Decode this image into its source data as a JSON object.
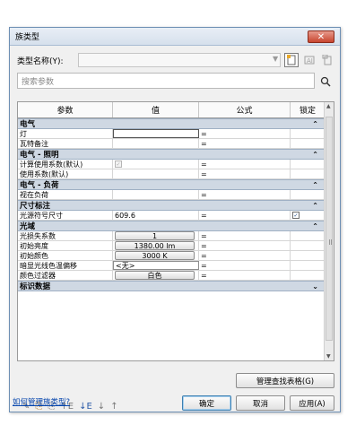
{
  "window": {
    "title": "族类型",
    "close": "✕"
  },
  "type_name": {
    "label": "类型名称(Y):",
    "value": ""
  },
  "search": {
    "placeholder": "搜索参数"
  },
  "grid": {
    "headers": [
      "参数",
      "值",
      "公式",
      "锁定"
    ],
    "groups": [
      {
        "title": "电气",
        "chevron": "⌃",
        "rows": [
          {
            "param": "灯",
            "value": "",
            "formula": "=",
            "kind": "boxed"
          },
          {
            "param": "瓦特备注",
            "value": "",
            "formula": "=",
            "kind": "plain"
          }
        ]
      },
      {
        "title": "电气 - 照明",
        "chevron": "⌃",
        "rows": [
          {
            "param": "计算使用系数(默认)",
            "value": "",
            "formula": "=",
            "kind": "checkbox-disabled"
          },
          {
            "param": "使用系数(默认)",
            "value": "",
            "formula": "=",
            "kind": "plain"
          }
        ]
      },
      {
        "title": "电气 - 负荷",
        "chevron": "⌃",
        "rows": [
          {
            "param": "视在负荷",
            "value": "",
            "formula": "=",
            "kind": "plain"
          }
        ]
      },
      {
        "title": "尺寸标注",
        "chevron": "⌃",
        "rows": [
          {
            "param": "光源符号尺寸",
            "value": "609.6",
            "formula": "=",
            "kind": "plain",
            "locked": true
          }
        ]
      },
      {
        "title": "光域",
        "chevron": "⌃",
        "rows": [
          {
            "param": "光损失系数",
            "value": "1",
            "formula": "=",
            "kind": "button"
          },
          {
            "param": "初始亮度",
            "value": "1380.00 lm",
            "formula": "=",
            "kind": "button"
          },
          {
            "param": "初始颜色",
            "value": "3000 K",
            "formula": "=",
            "kind": "button"
          },
          {
            "param": "暗显光线色温偏移",
            "value": "<无>",
            "formula": "=",
            "kind": "dropdown"
          },
          {
            "param": "颜色过滤器",
            "value": "白色",
            "formula": "=",
            "kind": "button"
          }
        ]
      },
      {
        "title": "标识数据",
        "chevron": "⌄",
        "rows": []
      }
    ]
  },
  "icons": [
    "pencil-icon",
    "new-type-icon",
    "duplicate-type-icon",
    "add-parameter-icon",
    "remove-parameter-icon",
    "sort-ascending-icon",
    "sort-descending-icon"
  ],
  "toolbar_glyphs": [
    "✎",
    "⎘",
    "⎘",
    "↑E",
    "↓E",
    "↓",
    "↑"
  ],
  "buttons": {
    "manage_lookup": "管理查找表格(G)",
    "ok": "确定",
    "cancel": "取消",
    "apply": "应用(A)"
  },
  "link": "如何管理族类型?"
}
